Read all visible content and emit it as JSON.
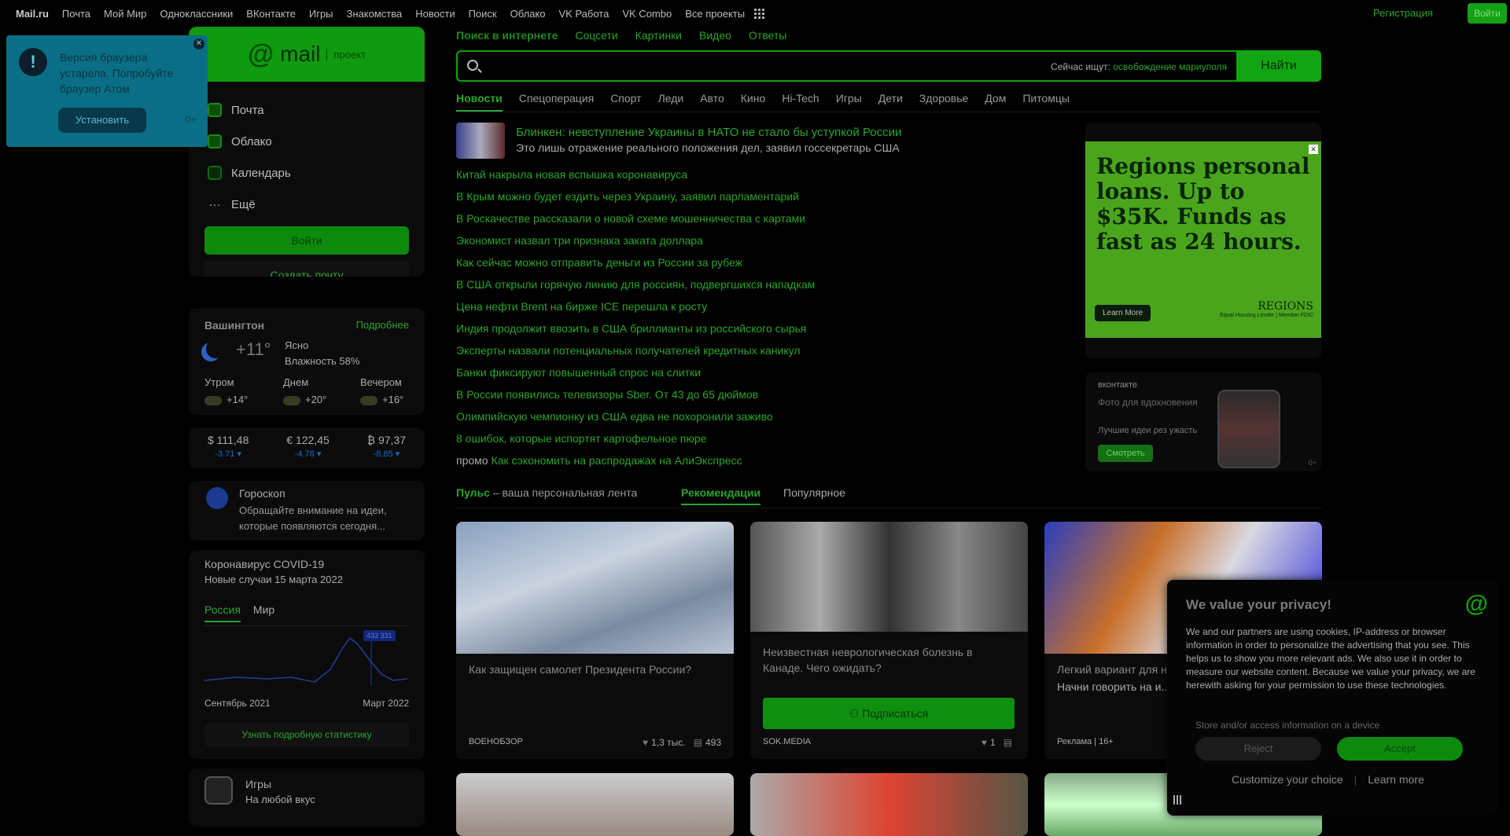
{
  "topbar": {
    "links": [
      "Mail.ru",
      "Почта",
      "Мой Мир",
      "Одноклассники",
      "ВКонтакте",
      "Игры",
      "Знакомства",
      "Новости",
      "Поиск",
      "Облако",
      "VK Работа",
      "VK Combo",
      "Все проекты"
    ],
    "register": "Регистрация",
    "login": "Войти"
  },
  "popup": {
    "message": "Версия браузера устарела. Попробуйте браузер Атом",
    "install": "Установить",
    "counter": "0+"
  },
  "mailbox": {
    "brand_at": "@",
    "brand_word": "mail",
    "brand_project": "проект",
    "items": [
      "Почта",
      "Облако",
      "Календарь",
      "Ещё"
    ],
    "login_button": "Войти",
    "create_button": "Создать почту"
  },
  "weather": {
    "city": "Вашингтон",
    "more": "Подробнее",
    "temp": "+11°",
    "condition": "Ясно",
    "humidity": "Влажность 58%",
    "forecast": [
      {
        "label": "Утром",
        "temp": "+14°"
      },
      {
        "label": "Днем",
        "temp": "+20°"
      },
      {
        "label": "Вечером",
        "temp": "+16°"
      }
    ]
  },
  "rates": [
    {
      "symbol": "$",
      "value": "111,48",
      "change": "-3.71 ▾"
    },
    {
      "symbol": "€",
      "value": "122,45",
      "change": "-4.78 ▾"
    },
    {
      "symbol": "₿",
      "value": "97,37",
      "change": "-8.85 ▾"
    }
  ],
  "horoscope": {
    "title": "Гороскоп",
    "text": "Обращайте внимание на идеи, которые появляются сегодня..."
  },
  "covid": {
    "title": "Коронавирус COVID-19",
    "subtitle": "Новые случаи 15 марта 2022",
    "tabs": [
      "Россия",
      "Мир"
    ],
    "badge": "433 331",
    "x_start": "Сентябрь 2021",
    "x_end": "Март 2022",
    "button": "Узнать подробную статистику"
  },
  "games": {
    "title": "Игры",
    "subtitle": "На любой вкус"
  },
  "search": {
    "tabs": [
      "Поиск в интернете",
      "Соцсети",
      "Картинки",
      "Видео",
      "Ответы"
    ],
    "hint_prefix": "Сейчас ищут:",
    "hint_query": "освобождение мариуполя",
    "button": "Найти"
  },
  "news_tabs": [
    "Новости",
    "Спецоперация",
    "Спорт",
    "Леди",
    "Авто",
    "Кино",
    "Hi-Tech",
    "Игры",
    "Дети",
    "Здоровье",
    "Дом",
    "Питомцы"
  ],
  "top_news": {
    "title": "Блинкен: невступление Украины в НАТО не стало бы уступкой России",
    "subtitle": "Это лишь отражение реального положения дел, заявил госсекретарь США"
  },
  "news": [
    "Китай накрыла новая вспышка коронавируса",
    "В Крым можно будет ездить через Украину, заявил парламентарий",
    "В Роскачестве рассказали о новой схеме мошенничества с картами",
    "Экономист назвал три признака заката доллара",
    "Как сейчас можно отправить деньги из России за рубеж",
    "В США открыли горячую линию для россиян, подвергшихся нападкам",
    "Цена нефти Brent на бирже ICE перешла к росту",
    "Индия продолжит ввозить в США бриллианты из российского сырья",
    "Эксперты назвали потенциальных получателей кредитных каникул",
    "Банки фиксируют повышенный спрос на слитки",
    "В России появились телевизоры Sber. От 43 до 65 дюймов",
    "Олимпийскую чемпионку из США едва не похоронили заживо",
    "8 ошибок, которые испортят картофельное пюре"
  ],
  "promo": {
    "label": "промо",
    "text": "Как сэкономить на распродажах на АлиЭкспресс"
  },
  "ad_regions": {
    "headline": "Regions personal loans. Up to $35K. Funds as fast as 24 hours.",
    "cta": "Learn More",
    "brand": "REGIONS",
    "fine": "Equal Housing Lender | Member FDIC"
  },
  "ad_vk": {
    "brand": "вконтакте",
    "title": "Фото для вдохновения",
    "sub": "Лучшие идеи рез ужасть",
    "cta": "Смотреть",
    "counter": "0+"
  },
  "feed": {
    "pulse": "Пульс",
    "pulse_sub": "– ваша персональная лента",
    "tab_rec": "Рекомендации",
    "tab_pop": "Популярное"
  },
  "cards": [
    {
      "title": "Как защищен самолет Президента России?",
      "source": "ВОЕНОБЗОР",
      "likes": "1,3 тыс.",
      "comments": "493"
    },
    {
      "title": "Неизвестная неврологическая болезнь в Канаде. Чего ожидать?",
      "source": "SOK.MEDIA",
      "likes": "1",
      "subscribe": "Подписаться"
    },
    {
      "title": "Легкий вариант для н...",
      "text": "Начни говорить на и... Получи доступ к вид...",
      "source": "Реклама | 16+"
    }
  ],
  "cookie": {
    "title": "We value your privacy!",
    "body": "We and our partners are using cookies, IP-address or browser information in order to personalize the advertising that you see. This helps us to show you more relevant ads. We also use it in order to measure our website content. Because we value your privacy, we are herewith asking for your permission to use these technologies.",
    "store": "Store and/or access information on a device",
    "reject": "Reject",
    "accept": "Accept",
    "customize": "Customize your choice",
    "learn": "Learn more",
    "separator": "|"
  }
}
